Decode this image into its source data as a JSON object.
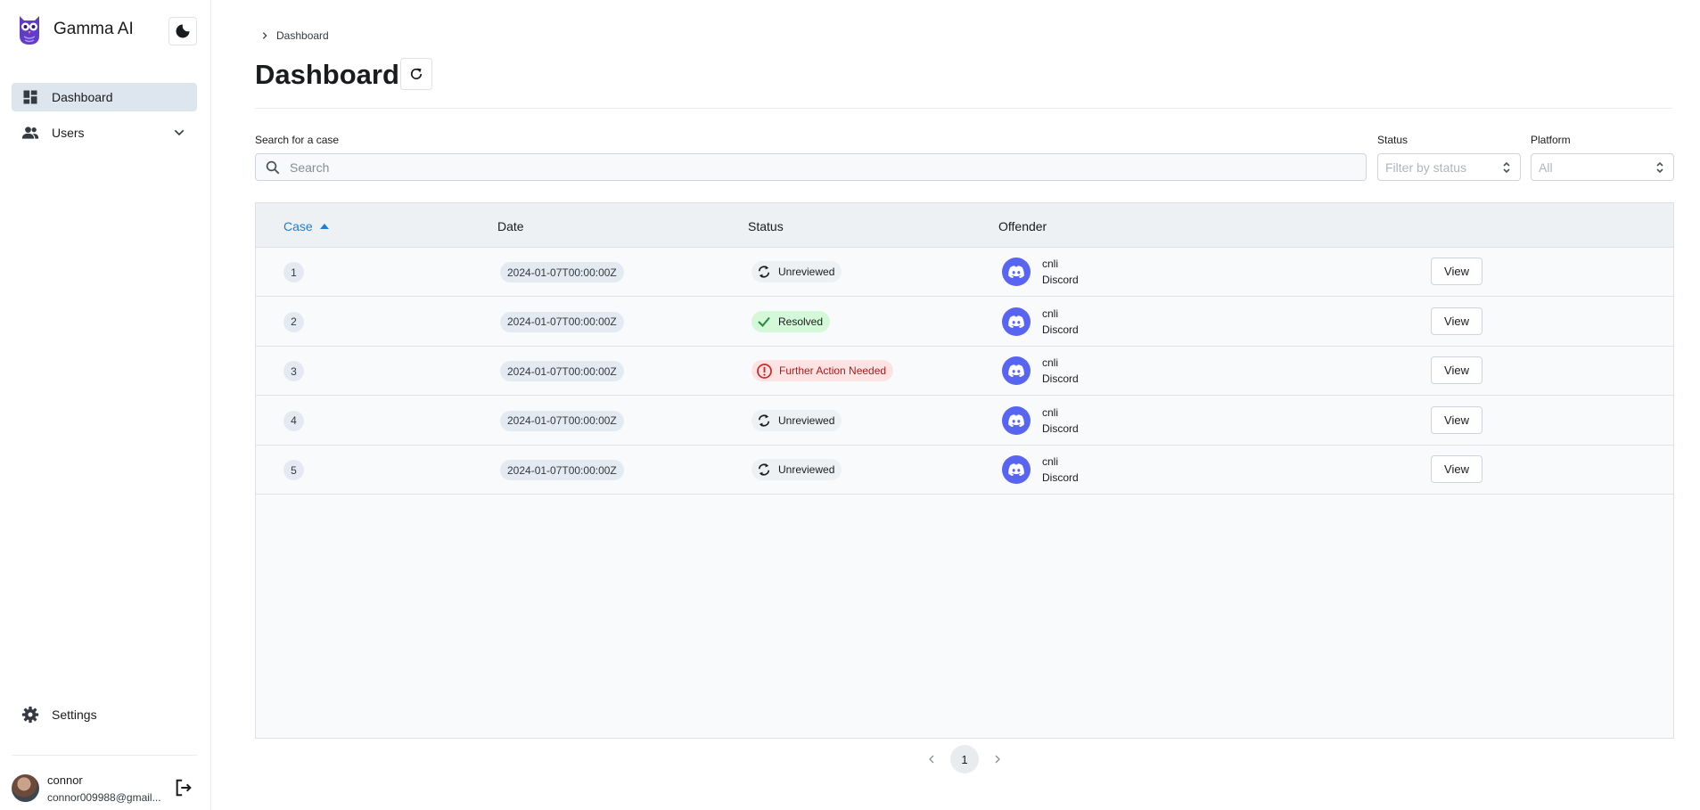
{
  "app": {
    "name": "Gamma AI"
  },
  "sidebar": {
    "items": [
      {
        "label": "Dashboard",
        "icon": "dashboard-icon",
        "active": true
      },
      {
        "label": "Users",
        "icon": "users-icon",
        "expandable": true
      }
    ],
    "settings_label": "Settings",
    "user": {
      "name": "connor",
      "email": "connor009988@gmail..."
    }
  },
  "breadcrumb": {
    "current": "Dashboard"
  },
  "page": {
    "title": "Dashboard"
  },
  "filters": {
    "search_label": "Search for a case",
    "search_placeholder": "Search",
    "status_label": "Status",
    "status_placeholder": "Filter by status",
    "platform_label": "Platform",
    "platform_value": "All"
  },
  "table": {
    "columns": [
      "Case",
      "Date",
      "Status",
      "Offender"
    ],
    "sorted_column": "Case",
    "sort_direction": "ascending",
    "rows": [
      {
        "case": "1",
        "date": "2024-01-07T00:00:00Z",
        "status": "Unreviewed",
        "status_kind": "unreviewed",
        "offender": "cnli",
        "platform": "Discord",
        "action": "View"
      },
      {
        "case": "2",
        "date": "2024-01-07T00:00:00Z",
        "status": "Resolved",
        "status_kind": "resolved",
        "offender": "cnli",
        "platform": "Discord",
        "action": "View"
      },
      {
        "case": "3",
        "date": "2024-01-07T00:00:00Z",
        "status": "Further Action Needed",
        "status_kind": "action",
        "offender": "cnli",
        "platform": "Discord",
        "action": "View"
      },
      {
        "case": "4",
        "date": "2024-01-07T00:00:00Z",
        "status": "Unreviewed",
        "status_kind": "unreviewed",
        "offender": "cnli",
        "platform": "Discord",
        "action": "View"
      },
      {
        "case": "5",
        "date": "2024-01-07T00:00:00Z",
        "status": "Unreviewed",
        "status_kind": "unreviewed",
        "offender": "cnli",
        "platform": "Discord",
        "action": "View"
      }
    ]
  },
  "pagination": {
    "current": "1"
  },
  "colors": {
    "accent": "#1c7ed6",
    "discord": "#5865f2",
    "resolved": "#2f9e44",
    "action_needed": "#c92a2a",
    "brand": "#5f3dc4"
  }
}
